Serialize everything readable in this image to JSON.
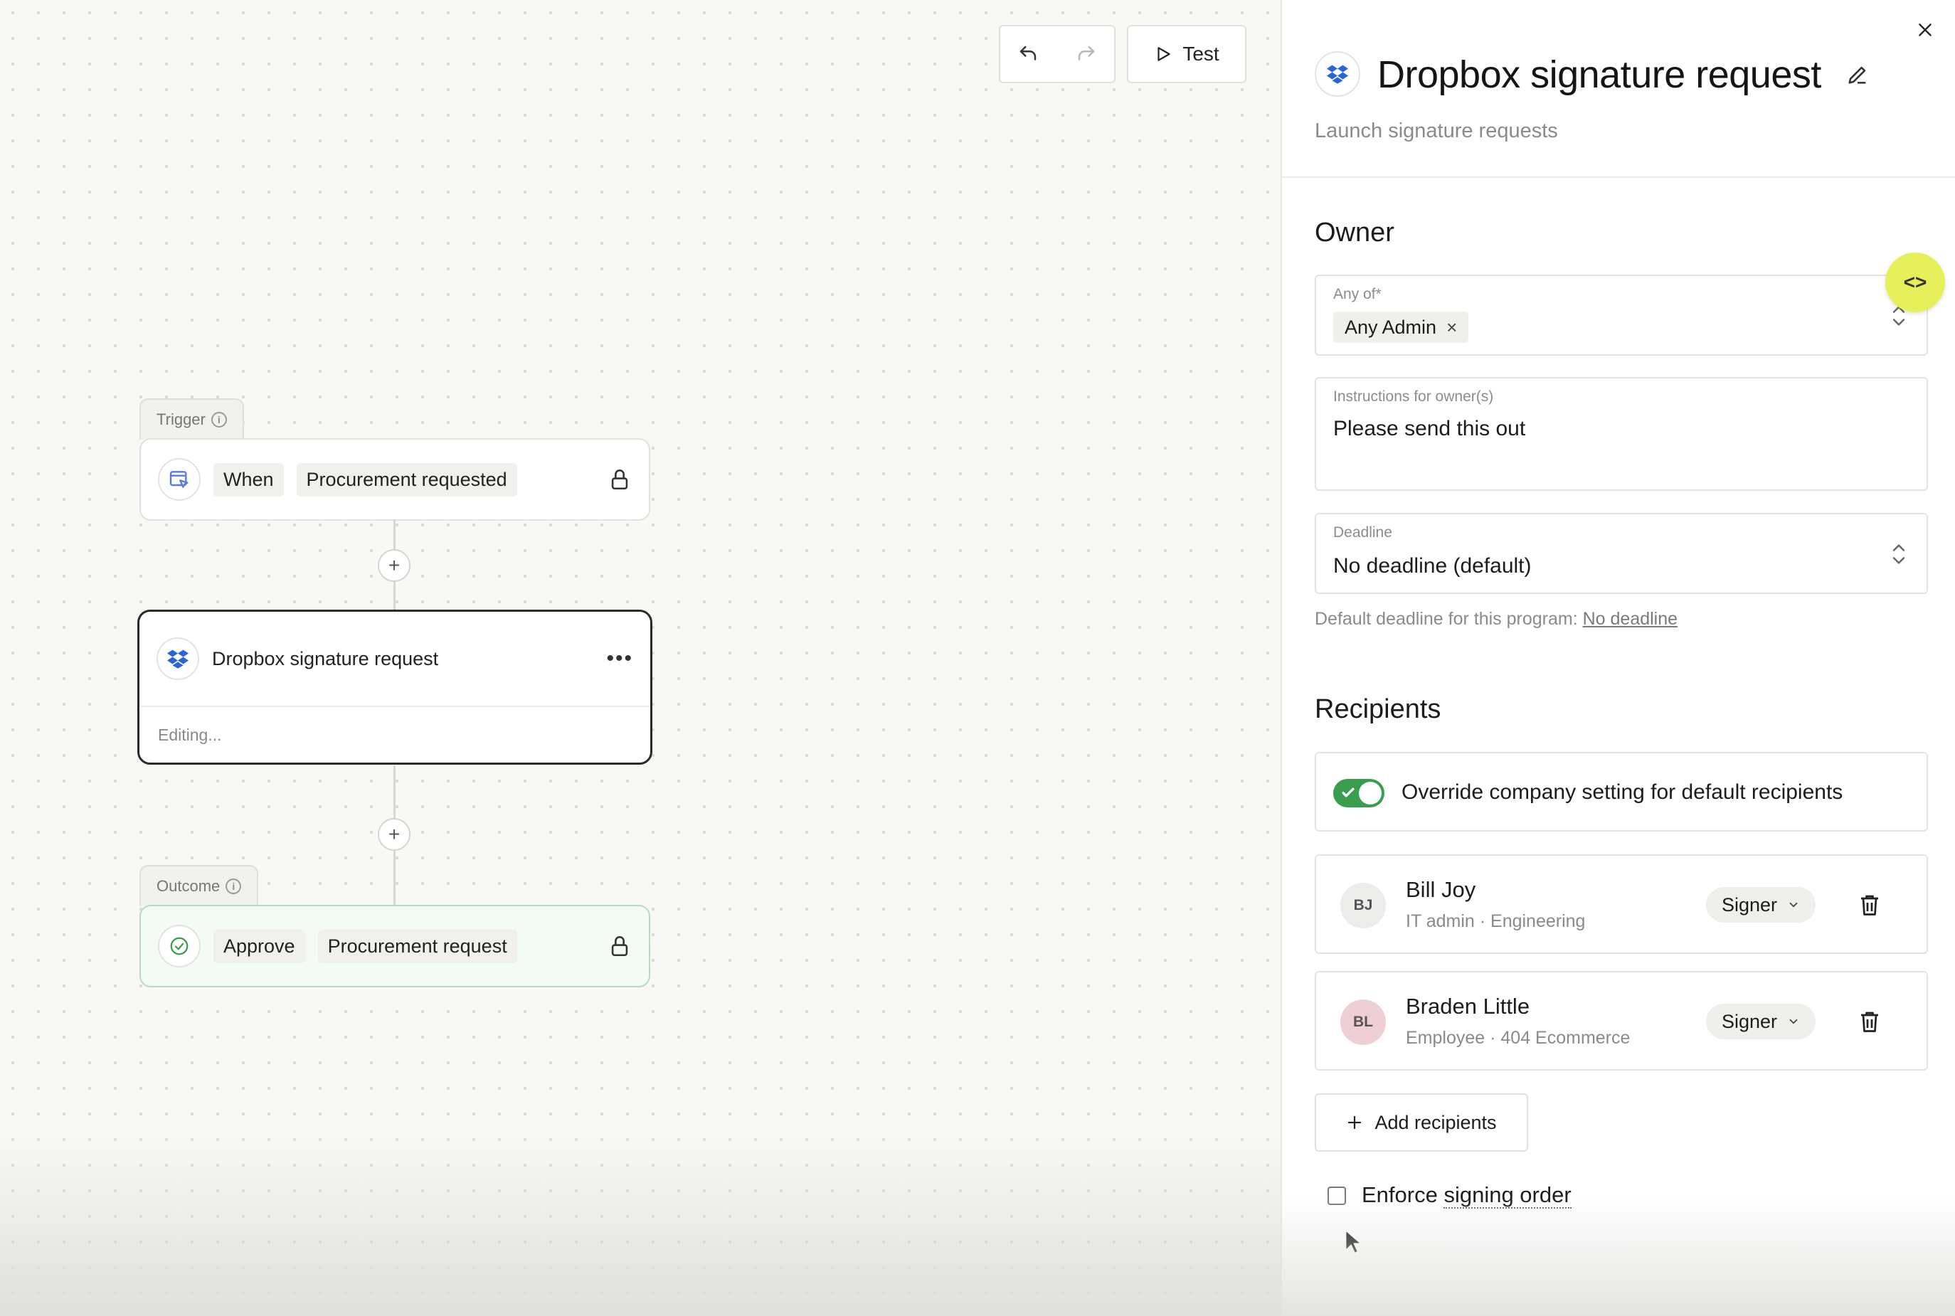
{
  "toolbar": {
    "undo_icon": "undo-icon",
    "redo_icon": "redo-icon",
    "test_label": "Test"
  },
  "canvas": {
    "trigger": {
      "tab_label": "Trigger",
      "when_label": "When",
      "event_label": "Procurement requested"
    },
    "action": {
      "title": "Dropbox signature request",
      "status": "Editing..."
    },
    "outcome": {
      "tab_label": "Outcome",
      "action_label": "Approve",
      "target_label": "Procurement request"
    }
  },
  "panel": {
    "title": "Dropbox signature request",
    "subtitle": "Launch signature requests",
    "owner": {
      "section_title": "Owner",
      "any_of_label": "Any of*",
      "chip_label": "Any Admin",
      "instructions_label": "Instructions for owner(s)",
      "instructions_value": "Please send this out",
      "deadline_label": "Deadline",
      "deadline_value": "No deadline (default)",
      "hint_prefix": "Default deadline for this program:",
      "hint_link": "No deadline"
    },
    "recipients": {
      "section_title": "Recipients",
      "override_label": "Override company setting for default recipients",
      "override_enabled": true,
      "list": [
        {
          "initials": "BJ",
          "name": "Bill Joy",
          "meta": "IT admin · Engineering",
          "role": "Signer",
          "avatar_color": "#ececea"
        },
        {
          "initials": "BL",
          "name": "Braden Little",
          "meta": "Employee · 404 Ecommerce",
          "role": "Signer",
          "avatar_color": "#efcfd6"
        }
      ],
      "add_label": "Add recipients",
      "enforce_prefix": "Enforce ",
      "enforce_underlined": "signing order"
    }
  },
  "colors": {
    "accent_green": "#3a9d4e",
    "dropbox_blue": "#2a64d6",
    "code_fab": "#e6f05a",
    "outcome_border": "#b7dcc0"
  }
}
